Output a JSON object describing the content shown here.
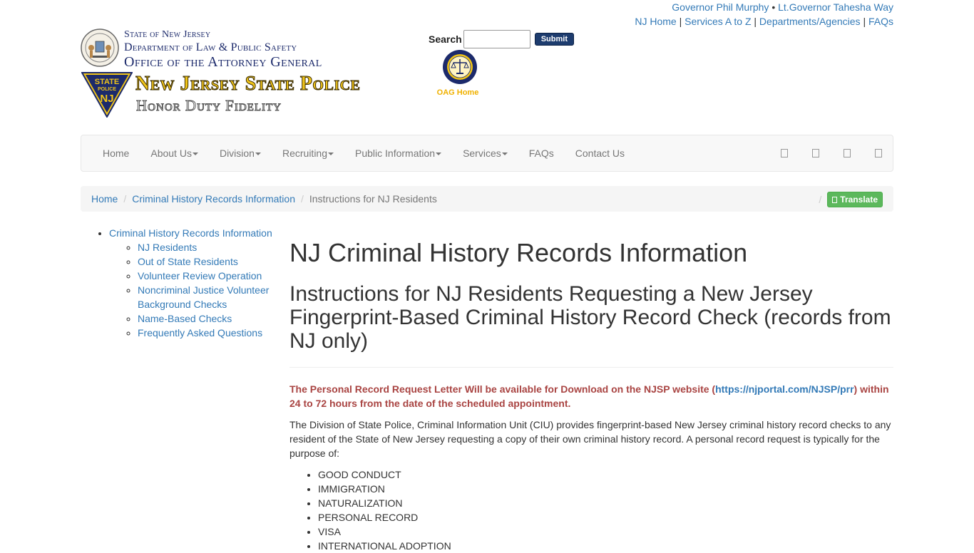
{
  "top_links": {
    "governor": "Governor Phil Murphy",
    "bullet": "•",
    "lt_governor": "Lt.Governor Tahesha Way",
    "nj_home": "NJ Home",
    "services_az": "Services A to Z",
    "departments": "Departments/Agencies",
    "faqs": "FAQs",
    "pipe": "|"
  },
  "header": {
    "state_line1": "State of New Jersey",
    "state_line2": "Department of Law & Public Safety",
    "state_line3": "Office of the Attorney General",
    "njsp_title": "New Jersey State Police",
    "njsp_motto": "Honor Duty Fidelity",
    "badge_line1": "STATE",
    "badge_line2": "POLICE",
    "badge_line3": "NJ",
    "search_label": "Search",
    "search_placeholder": "",
    "submit_label": "Submit",
    "oag_label": "OAG Home"
  },
  "nav": {
    "items": [
      {
        "label": "Home",
        "dropdown": false
      },
      {
        "label": "About Us",
        "dropdown": true
      },
      {
        "label": "Division",
        "dropdown": true
      },
      {
        "label": "Recruiting",
        "dropdown": true
      },
      {
        "label": "Public Information",
        "dropdown": true
      },
      {
        "label": "Services",
        "dropdown": true
      },
      {
        "label": "FAQs",
        "dropdown": false
      },
      {
        "label": "Contact Us",
        "dropdown": false
      }
    ],
    "social_icons": [
      "facebook-icon",
      "twitter-icon",
      "youtube-icon",
      "instagram-icon"
    ]
  },
  "breadcrumb": {
    "home": "Home",
    "section": "Criminal History Records Information",
    "current": "Instructions for NJ Residents",
    "divider": "/",
    "translate_label": "Translate"
  },
  "sidebar": {
    "parent": "Criminal History Records Information",
    "children": [
      "NJ Residents",
      "Out of State Residents",
      "Volunteer Review Operation",
      "Noncriminal Justice Volunteer Background Checks",
      "Name-Based Checks",
      "Frequently Asked Questions"
    ]
  },
  "main": {
    "title": "NJ Criminal History Records Information",
    "subtitle": "Instructions for NJ Residents Requesting a New Jersey Fingerprint-Based Criminal History Record Check (records from NJ only)",
    "notice_before": "The Personal Record Request Letter Will be available for Download on the NJSP website (",
    "notice_link": "https://njportal.com/NJSP/prr",
    "notice_after": ") within 24 to 72 hours from the date of the scheduled appointment.",
    "intro": "The Division of State Police, Criminal Information Unit (CIU) provides fingerprint-based New Jersey criminal history record checks to any resident of the State of New Jersey requesting a copy of their own criminal history record. A personal record request is typically for the purpose of:",
    "purposes": [
      "GOOD CONDUCT",
      "IMMIGRATION",
      "NATURALIZATION",
      "PERSONAL RECORD",
      "VISA",
      "INTERNATIONAL ADOPTION"
    ]
  },
  "colors": {
    "link": "#337ab7",
    "notice_red": "#a94442",
    "translate_green": "#5cb85c",
    "submit_navy": "#1d3c6e",
    "njsp_gold": "#f0c419"
  }
}
